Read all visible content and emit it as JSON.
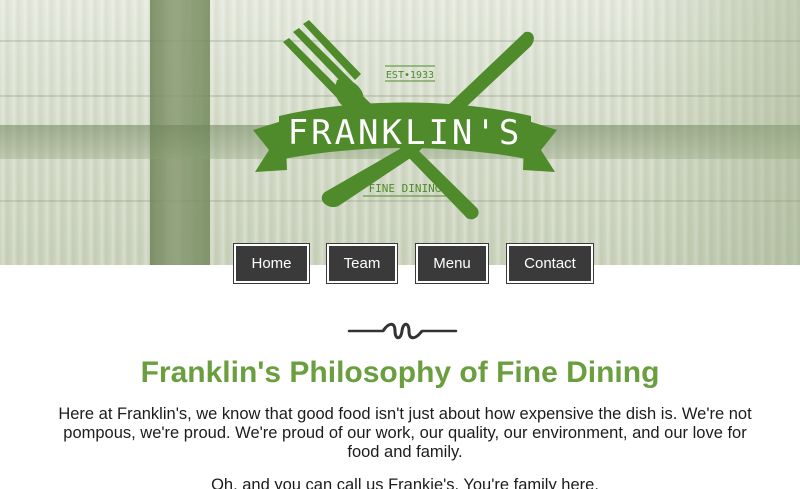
{
  "brand": {
    "name": "FRANKLIN'S",
    "established": "EST•1933",
    "tagline": "FINE DINING"
  },
  "nav": {
    "items": [
      {
        "label": "Home"
      },
      {
        "label": "Team"
      },
      {
        "label": "Menu"
      },
      {
        "label": "Contact"
      }
    ]
  },
  "main": {
    "heading": "Franklin's Philosophy of Fine Dining",
    "paragraph1": "Here at Franklin's, we know that good food isn't just about how expensive the dish is. We're not pompous, we're proud. We're proud of our work, our quality, our environment, and our love for food and family.",
    "paragraph2": "Oh, and you can call us Frankie's. You're family here."
  },
  "colors": {
    "accent_green": "#6a9e3e",
    "logo_green": "#4f8a2b",
    "nav_bg": "#3a3a3a"
  }
}
